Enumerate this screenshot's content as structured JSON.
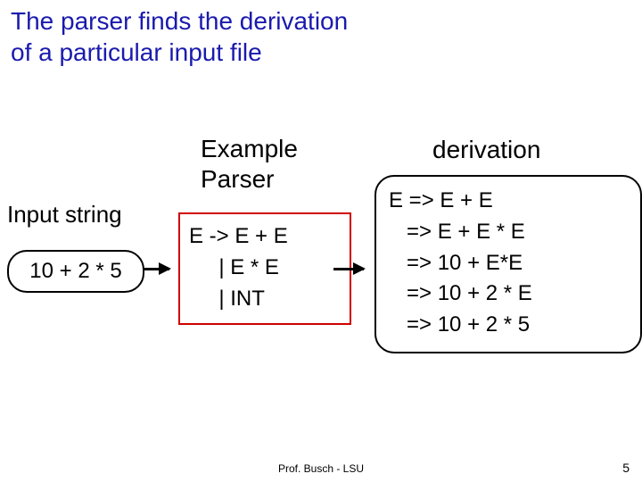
{
  "title_line1": "The parser finds the derivation",
  "title_line2": "of a particular input file",
  "input_label": "Input string",
  "input_value": "10 + 2 * 5",
  "parser_title_line1": "Example",
  "parser_title_line2": "Parser",
  "grammar": {
    "lines": [
      "E -> E + E",
      "     | E * E",
      "     | INT"
    ]
  },
  "derivation_title": "derivation",
  "derivation": {
    "lines": [
      "E => E + E",
      "   => E + E * E",
      "   => 10 + E*E",
      "   => 10 + 2 * E",
      "   => 10 + 2 * 5"
    ]
  },
  "footer": "Prof. Busch - LSU",
  "page_number": "5"
}
